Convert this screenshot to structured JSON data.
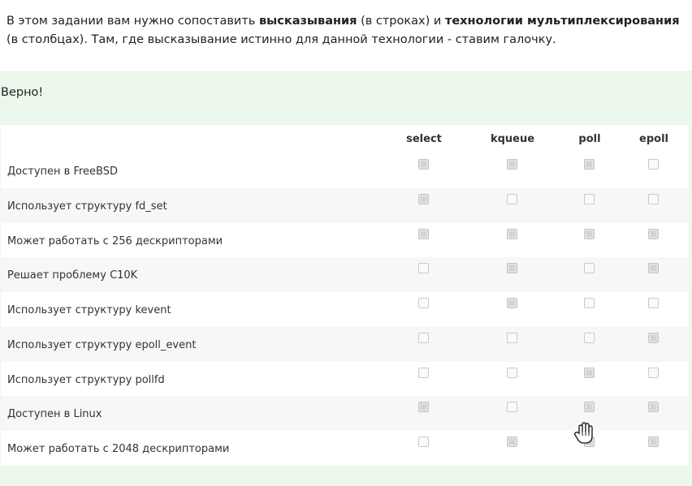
{
  "intro": {
    "part1": "В этом задании вам нужно сопоставить ",
    "bold1": "высказывания",
    "part2": " (в строках) и ",
    "bold2": "технологии мультиплексирования",
    "part3": " (в столбцах). Там, где высказывание истинно для данной технологии - ставим галочку."
  },
  "feedback": {
    "verdict": "Верно!"
  },
  "matrix": {
    "columns": [
      "select",
      "kqueue",
      "poll",
      "epoll"
    ],
    "rows": [
      {
        "label": "Доступен в FreeBSD",
        "checks": [
          true,
          true,
          true,
          false
        ]
      },
      {
        "label": "Использует структуру fd_set",
        "checks": [
          true,
          false,
          false,
          false
        ]
      },
      {
        "label": "Может работать с 256 дескрипторами",
        "checks": [
          true,
          true,
          true,
          true
        ]
      },
      {
        "label": "Решает проблему C10K",
        "checks": [
          false,
          true,
          false,
          true
        ]
      },
      {
        "label": "Использует структуру kevent",
        "checks": [
          false,
          true,
          false,
          false
        ]
      },
      {
        "label": "Использует структуру epoll_event",
        "checks": [
          false,
          false,
          false,
          true
        ]
      },
      {
        "label": "Использует структуру pollfd",
        "checks": [
          false,
          false,
          true,
          false
        ]
      },
      {
        "label": "Доступен в Linux",
        "checks": [
          true,
          false,
          true,
          true
        ]
      },
      {
        "label": "Может работать с 2048 дескрипторами",
        "checks": [
          false,
          true,
          true,
          true
        ]
      }
    ]
  },
  "cursor": {
    "icon": "hand-cursor-icon"
  }
}
